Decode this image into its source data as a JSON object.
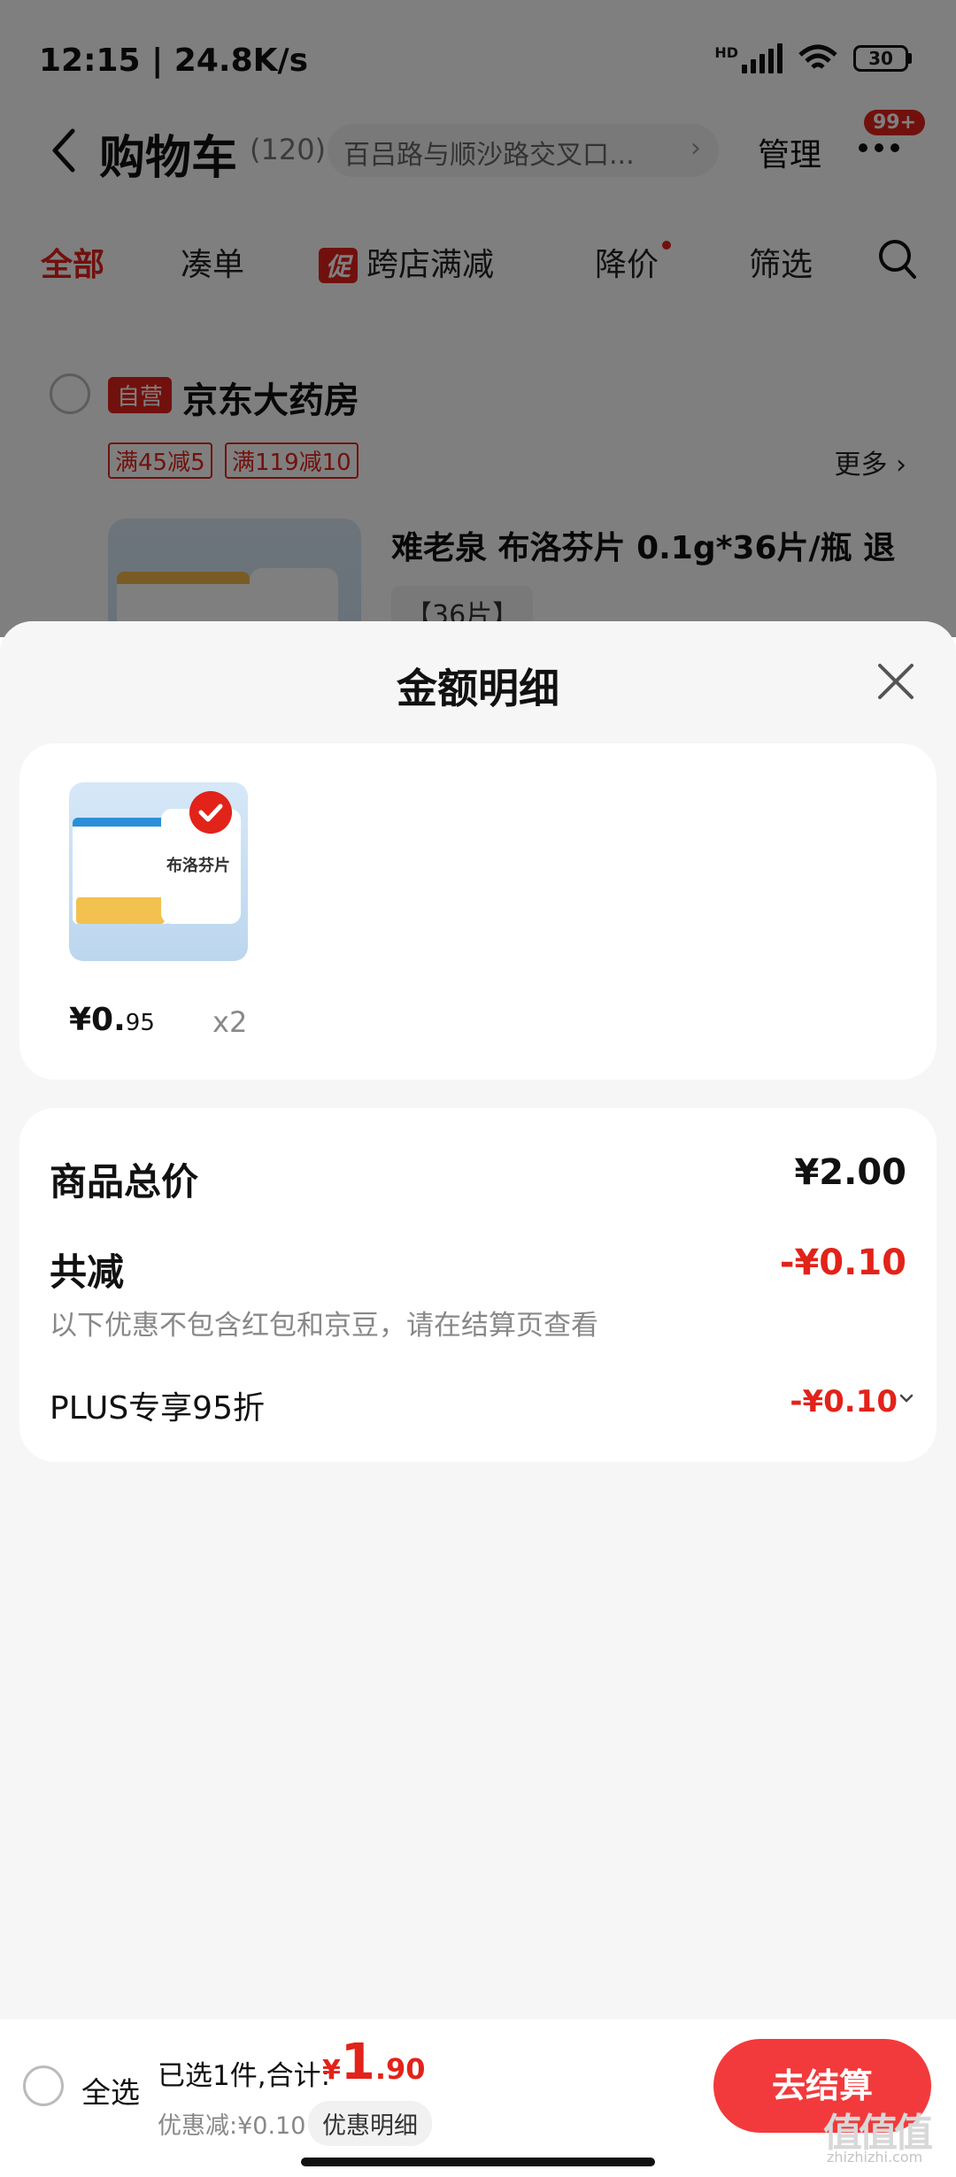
{
  "status_bar": {
    "time": "12:15 | 24.8K/s",
    "network_label": "HD",
    "battery": "30"
  },
  "nav": {
    "title": "购物车",
    "count": "(120)",
    "address": "百吕路与顺沙路交叉口...",
    "manage": "管理",
    "badge": "99+"
  },
  "tabs": {
    "all": "全部",
    "bundle": "凑单",
    "promo_icon": "促",
    "cross_store": "跨店满减",
    "price_drop": "降价",
    "filter": "筛选"
  },
  "store": {
    "self_tag": "自营",
    "name": "京东大药房",
    "coupons": [
      "满45减5",
      "满119减10"
    ],
    "more": "更多",
    "product_title": "难老泉 布洛芬片 0.1g*36片/瓶 退",
    "product_spec": "【36片】"
  },
  "sheet": {
    "title": "金额明细",
    "item": {
      "thumb_label": "布洛芬片",
      "price_main": "¥0.",
      "price_dec": "95",
      "qty": "x2"
    },
    "summary": {
      "total_label": "商品总价",
      "total_value": "¥2.00",
      "discount_label": "共减",
      "discount_value": "-¥0.10",
      "note": "以下优惠不包含红包和京豆，请在结算页查看",
      "plus_label": "PLUS专享95折",
      "plus_value": "-¥0.10"
    }
  },
  "bottom_bar": {
    "select_all": "全选",
    "selected_text": "已选1件,合计:",
    "currency": "¥",
    "total_int": "1",
    "total_dec": ".90",
    "discount_text": "优惠减:¥0.10",
    "detail_chip": "优惠明细",
    "checkout": "去结算"
  },
  "watermark": {
    "main": "值值值",
    "sub": "zhizhizhi.com"
  },
  "colors": {
    "accent": "#e2231a",
    "checkout": "#f23a3c",
    "sheet_bg": "#f6f6f6"
  }
}
